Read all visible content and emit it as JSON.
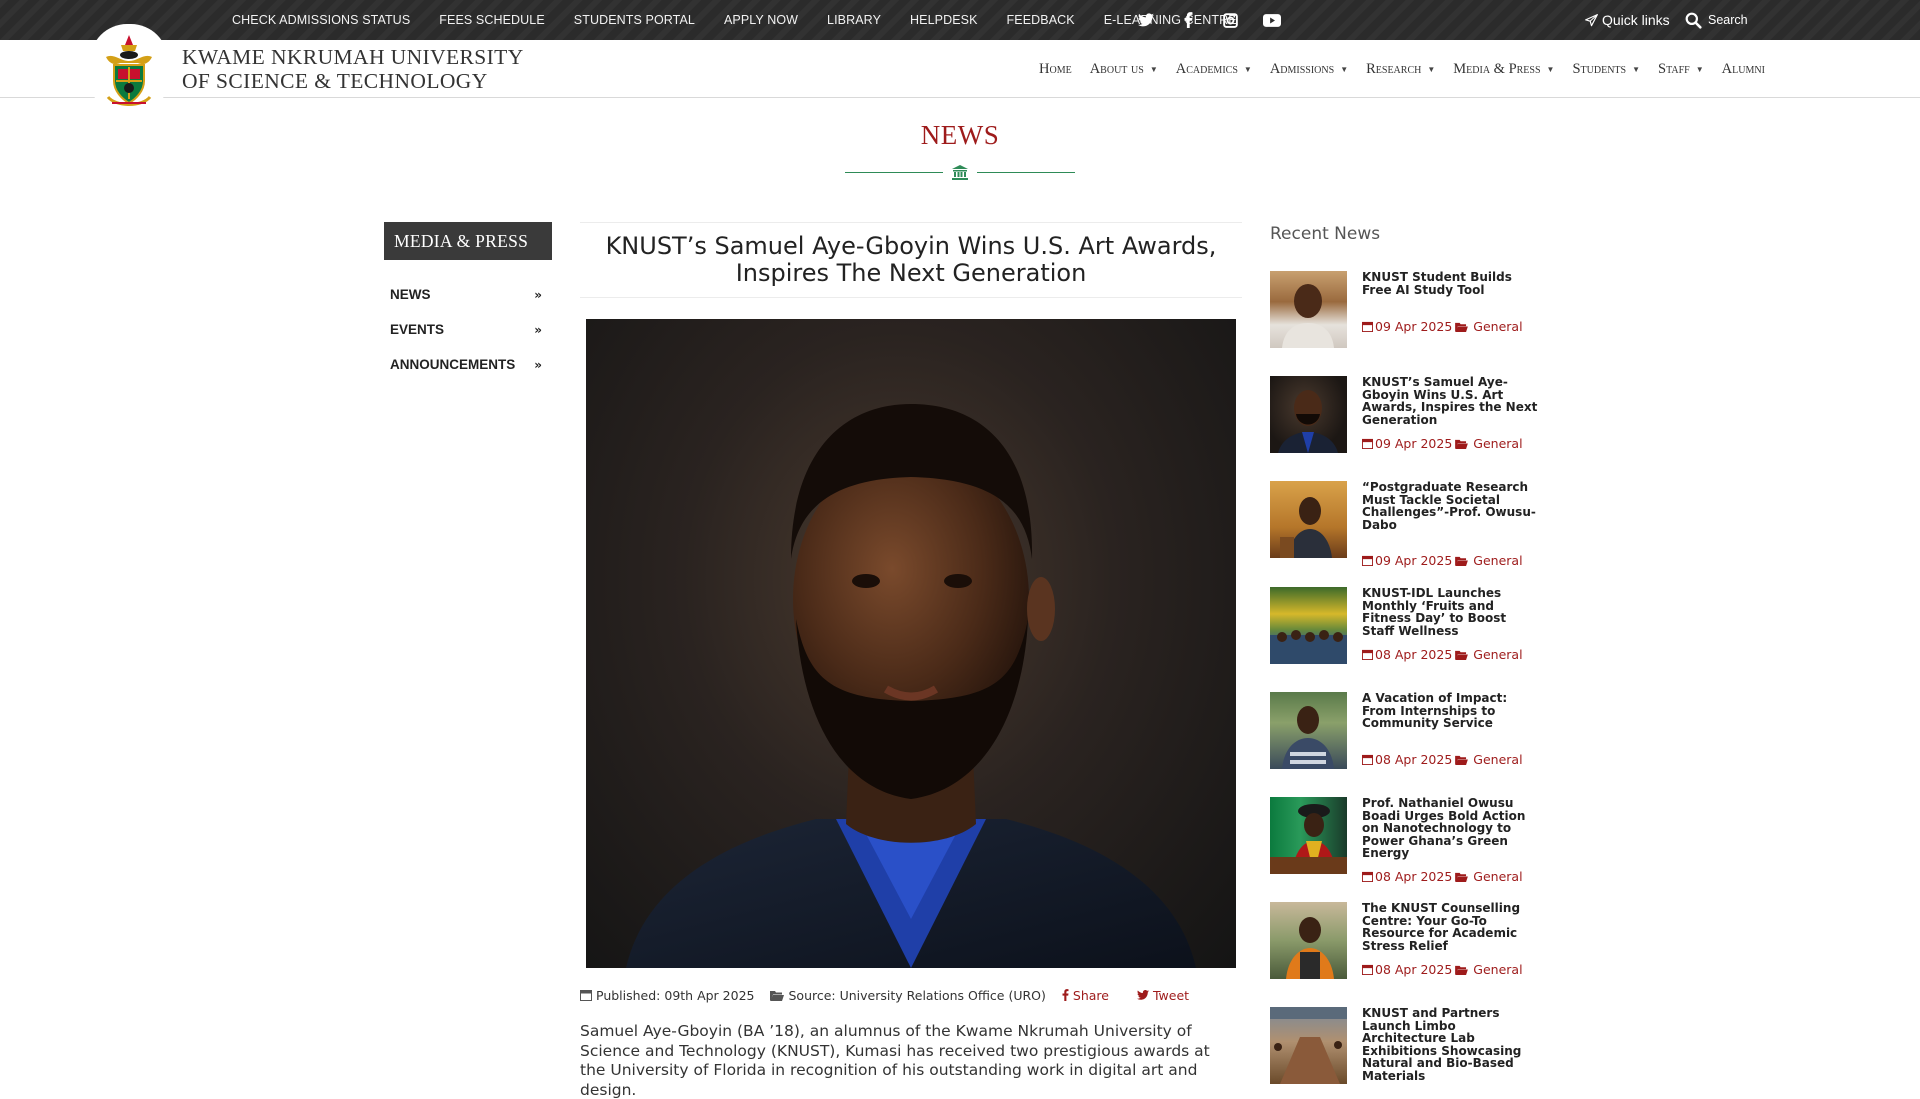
{
  "topbar": {
    "links": [
      "CHECK ADMISSIONS STATUS",
      "FEES SCHEDULE",
      "STUDENTS PORTAL",
      "APPLY NOW",
      "LIBRARY",
      "HELPDESK",
      "FEEDBACK",
      "E-LEARNING CENTRE"
    ],
    "social_icons": [
      "twitter-icon",
      "facebook-icon",
      "instagram-icon",
      "youtube-icon"
    ],
    "quick_links_label": "Quick links",
    "search_label": "Search"
  },
  "header": {
    "university_line1": "KWAME NKRUMAH UNIVERSITY",
    "university_line2": "OF SCIENCE & TECHNOLOGY",
    "nav": [
      {
        "label": "Home",
        "dropdown": false
      },
      {
        "label": "About us",
        "dropdown": true
      },
      {
        "label": "Academics",
        "dropdown": true
      },
      {
        "label": "Admissions",
        "dropdown": true
      },
      {
        "label": "Research",
        "dropdown": true
      },
      {
        "label": "Media & Press",
        "dropdown": true
      },
      {
        "label": "Students",
        "dropdown": true
      },
      {
        "label": "Staff",
        "dropdown": true
      },
      {
        "label": "Alumni",
        "dropdown": false
      }
    ]
  },
  "page": {
    "section_title": "NEWS"
  },
  "sidebar": {
    "heading": "MEDIA & PRESS",
    "items": [
      {
        "label": "NEWS"
      },
      {
        "label": "EVENTS"
      },
      {
        "label": "ANNOUNCEMENTS"
      }
    ]
  },
  "article": {
    "title": "KNUST’s Samuel Aye-Gboyin Wins U.S. Art Awards, Inspires The Next Generation",
    "published": "Published: 09th Apr 2025",
    "source": "Source: University Relations Office (URO)",
    "share_label": "Share",
    "tweet_label": "Tweet",
    "paragraph1": "Samuel Aye-Gboyin (BA ’18), an alumnus of the Kwame Nkrumah University of Science and Technology (KNUST), Kumasi has received two prestigious awards at the University of Florida in recognition of his outstanding work in digital art and design."
  },
  "recent": {
    "heading": "Recent News",
    "items": [
      {
        "title": "KNUST Student Builds Free AI Study Tool",
        "date": "09 Apr 2025",
        "category": "General"
      },
      {
        "title": "KNUST’s Samuel Aye-Gboyin Wins U.S. Art Awards, Inspires the Next Generation",
        "date": "09 Apr 2025",
        "category": "General"
      },
      {
        "title": "“Postgraduate Research Must Tackle Societal Challenges”-Prof. Owusu-Dabo",
        "date": "09 Apr 2025",
        "category": "General"
      },
      {
        "title": "KNUST-IDL Launches Monthly ‘Fruits and Fitness Day’ to Boost Staff Wellness",
        "date": "08 Apr 2025",
        "category": "General"
      },
      {
        "title": "A Vacation of Impact: From Internships to Community Service",
        "date": "08 Apr 2025",
        "category": "General"
      },
      {
        "title": "Prof. Nathaniel Owusu Boadi Urges Bold Action on Nanotechnology to Power Ghana’s Green Energy",
        "date": "08 Apr 2025",
        "category": "General"
      },
      {
        "title": "The KNUST Counselling Centre: Your Go-To Resource for Academic Stress Relief",
        "date": "08 Apr 2025",
        "category": "General"
      },
      {
        "title": "KNUST and Partners Launch Limbo Architecture Lab Exhibitions Showcasing Natural and Bio-Based Materials",
        "date": "",
        "category": ""
      }
    ]
  },
  "colors": {
    "accent_red": "#9e1b1b",
    "divider_green": "#2e8b57",
    "topbar_bg": "#2b2b2b",
    "sidebar_head_bg": "#3a3a3a"
  }
}
